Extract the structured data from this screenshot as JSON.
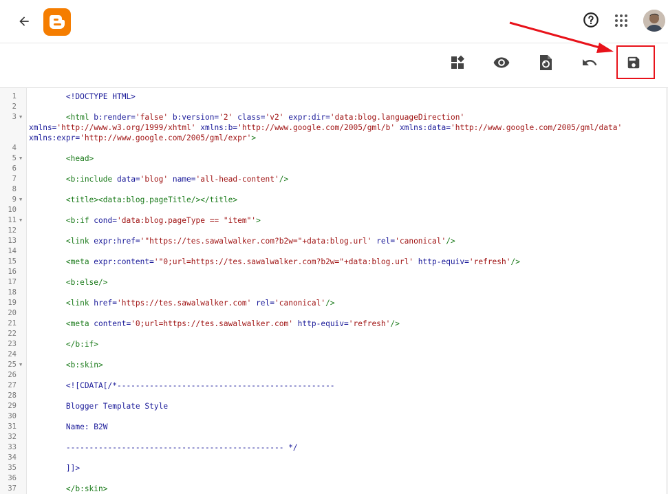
{
  "header": {
    "back_icon": "arrow-back-icon",
    "logo": "blogger-logo",
    "help_icon": "help-icon",
    "apps_icon": "apps-grid-icon",
    "avatar": "user-avatar"
  },
  "toolbar": {
    "buttons": [
      {
        "name": "jump-to-widget-button",
        "icon": "widgets-icon"
      },
      {
        "name": "preview-button",
        "icon": "eye-icon"
      },
      {
        "name": "format-template-button",
        "icon": "format-document-icon"
      },
      {
        "name": "revert-button",
        "icon": "undo-icon"
      },
      {
        "name": "save-button",
        "icon": "save-icon"
      }
    ]
  },
  "colors": {
    "logo": "#f57d00",
    "annotation": "#e8121a",
    "tag": "#1a7a1a",
    "attribute": "#1a1a99",
    "string": "#a01515"
  },
  "editor": {
    "lines": [
      {
        "n": "1",
        "fold": false,
        "wrap": 0,
        "parts": [
          {
            "t": "plain",
            "s": "        <!DOCTYPE HTML>"
          }
        ]
      },
      {
        "n": "2",
        "fold": false,
        "wrap": 0,
        "parts": []
      },
      {
        "n": "3",
        "fold": true,
        "wrap": 0,
        "parts": [
          {
            "t": "tag",
            "s": "        <html "
          },
          {
            "t": "attr",
            "s": "b:render="
          },
          {
            "t": "str",
            "s": "'false'"
          },
          {
            "t": "attr",
            "s": " b:version="
          },
          {
            "t": "str",
            "s": "'2'"
          },
          {
            "t": "attr",
            "s": " class="
          },
          {
            "t": "str",
            "s": "'v2'"
          },
          {
            "t": "attr",
            "s": " expr:dir="
          },
          {
            "t": "str",
            "s": "'data:blog.languageDirection'"
          }
        ]
      },
      {
        "n": "",
        "fold": false,
        "wrap": 1,
        "parts": [
          {
            "t": "attr",
            "s": "xmlns="
          },
          {
            "t": "str",
            "s": "'http://www.w3.org/1999/xhtml'"
          },
          {
            "t": "attr",
            "s": " xmlns:b="
          },
          {
            "t": "str",
            "s": "'http://www.google.com/2005/gml/b'"
          },
          {
            "t": "attr",
            "s": " xmlns:data="
          },
          {
            "t": "str",
            "s": "'http://www.google.com/2005/gml/data'"
          }
        ]
      },
      {
        "n": "",
        "fold": false,
        "wrap": 1,
        "parts": [
          {
            "t": "attr",
            "s": "xmlns:expr="
          },
          {
            "t": "str",
            "s": "'http://www.google.com/2005/gml/expr'"
          },
          {
            "t": "tag",
            "s": ">"
          }
        ]
      },
      {
        "n": "4",
        "fold": false,
        "wrap": 0,
        "parts": []
      },
      {
        "n": "5",
        "fold": true,
        "wrap": 0,
        "parts": [
          {
            "t": "tag",
            "s": "        <head>"
          }
        ]
      },
      {
        "n": "6",
        "fold": false,
        "wrap": 0,
        "parts": []
      },
      {
        "n": "7",
        "fold": false,
        "wrap": 0,
        "parts": [
          {
            "t": "tag",
            "s": "        <b:include "
          },
          {
            "t": "attr",
            "s": "data="
          },
          {
            "t": "str",
            "s": "'blog'"
          },
          {
            "t": "attr",
            "s": " name="
          },
          {
            "t": "str",
            "s": "'all-head-content'"
          },
          {
            "t": "tag",
            "s": "/>"
          }
        ]
      },
      {
        "n": "8",
        "fold": false,
        "wrap": 0,
        "parts": []
      },
      {
        "n": "9",
        "fold": true,
        "wrap": 0,
        "parts": [
          {
            "t": "tag",
            "s": "        <title><data:blog.pageTitle/></title>"
          }
        ]
      },
      {
        "n": "10",
        "fold": false,
        "wrap": 0,
        "parts": []
      },
      {
        "n": "11",
        "fold": true,
        "wrap": 0,
        "parts": [
          {
            "t": "tag",
            "s": "        <b:if "
          },
          {
            "t": "attr",
            "s": "cond="
          },
          {
            "t": "str",
            "s": "'data:blog.pageType == \"item\"'"
          },
          {
            "t": "tag",
            "s": ">"
          }
        ]
      },
      {
        "n": "12",
        "fold": false,
        "wrap": 0,
        "parts": []
      },
      {
        "n": "13",
        "fold": false,
        "wrap": 0,
        "parts": [
          {
            "t": "tag",
            "s": "        <link "
          },
          {
            "t": "attr",
            "s": "expr:href="
          },
          {
            "t": "str",
            "s": "'\"https://tes.sawalwalker.com?b2w=\"+data:blog.url'"
          },
          {
            "t": "attr",
            "s": " rel="
          },
          {
            "t": "str",
            "s": "'canonical'"
          },
          {
            "t": "tag",
            "s": "/>"
          }
        ]
      },
      {
        "n": "14",
        "fold": false,
        "wrap": 0,
        "parts": []
      },
      {
        "n": "15",
        "fold": false,
        "wrap": 0,
        "parts": [
          {
            "t": "tag",
            "s": "        <meta "
          },
          {
            "t": "attr",
            "s": "expr:content="
          },
          {
            "t": "str",
            "s": "'\"0;url=https://tes.sawalwalker.com?b2w=\"+data:blog.url'"
          },
          {
            "t": "attr",
            "s": " http-equiv="
          },
          {
            "t": "str",
            "s": "'refresh'"
          },
          {
            "t": "tag",
            "s": "/>"
          }
        ]
      },
      {
        "n": "16",
        "fold": false,
        "wrap": 0,
        "parts": []
      },
      {
        "n": "17",
        "fold": false,
        "wrap": 0,
        "parts": [
          {
            "t": "tag",
            "s": "        <b:else/>"
          }
        ]
      },
      {
        "n": "18",
        "fold": false,
        "wrap": 0,
        "parts": []
      },
      {
        "n": "19",
        "fold": false,
        "wrap": 0,
        "parts": [
          {
            "t": "tag",
            "s": "        <link "
          },
          {
            "t": "attr",
            "s": "href="
          },
          {
            "t": "str",
            "s": "'https://tes.sawalwalker.com'"
          },
          {
            "t": "attr",
            "s": " rel="
          },
          {
            "t": "str",
            "s": "'canonical'"
          },
          {
            "t": "tag",
            "s": "/>"
          }
        ]
      },
      {
        "n": "20",
        "fold": false,
        "wrap": 0,
        "parts": []
      },
      {
        "n": "21",
        "fold": false,
        "wrap": 0,
        "parts": [
          {
            "t": "tag",
            "s": "        <meta "
          },
          {
            "t": "attr",
            "s": "content="
          },
          {
            "t": "str",
            "s": "'0;url=https://tes.sawalwalker.com'"
          },
          {
            "t": "attr",
            "s": " http-equiv="
          },
          {
            "t": "str",
            "s": "'refresh'"
          },
          {
            "t": "tag",
            "s": "/>"
          }
        ]
      },
      {
        "n": "22",
        "fold": false,
        "wrap": 0,
        "parts": []
      },
      {
        "n": "23",
        "fold": false,
        "wrap": 0,
        "parts": [
          {
            "t": "tag",
            "s": "        </b:if>"
          }
        ]
      },
      {
        "n": "24",
        "fold": false,
        "wrap": 0,
        "parts": []
      },
      {
        "n": "25",
        "fold": true,
        "wrap": 0,
        "parts": [
          {
            "t": "tag",
            "s": "        <b:skin>"
          }
        ]
      },
      {
        "n": "26",
        "fold": false,
        "wrap": 0,
        "parts": []
      },
      {
        "n": "27",
        "fold": false,
        "wrap": 0,
        "parts": [
          {
            "t": "plain",
            "s": "        <![CDATA[/*-----------------------------------------------"
          }
        ]
      },
      {
        "n": "28",
        "fold": false,
        "wrap": 0,
        "parts": []
      },
      {
        "n": "29",
        "fold": false,
        "wrap": 0,
        "parts": [
          {
            "t": "plain",
            "s": "        Blogger Template Style"
          }
        ]
      },
      {
        "n": "30",
        "fold": false,
        "wrap": 0,
        "parts": []
      },
      {
        "n": "31",
        "fold": false,
        "wrap": 0,
        "parts": [
          {
            "t": "plain",
            "s": "        Name: B2W"
          }
        ]
      },
      {
        "n": "32",
        "fold": false,
        "wrap": 0,
        "parts": []
      },
      {
        "n": "33",
        "fold": false,
        "wrap": 0,
        "parts": [
          {
            "t": "plain",
            "s": "        ----------------------------------------------- */"
          }
        ]
      },
      {
        "n": "34",
        "fold": false,
        "wrap": 0,
        "parts": []
      },
      {
        "n": "35",
        "fold": false,
        "wrap": 0,
        "parts": [
          {
            "t": "plain",
            "s": "        ]]>"
          }
        ]
      },
      {
        "n": "36",
        "fold": false,
        "wrap": 0,
        "parts": []
      },
      {
        "n": "37",
        "fold": false,
        "wrap": 0,
        "parts": [
          {
            "t": "tag",
            "s": "        </b:skin>"
          }
        ]
      }
    ]
  }
}
